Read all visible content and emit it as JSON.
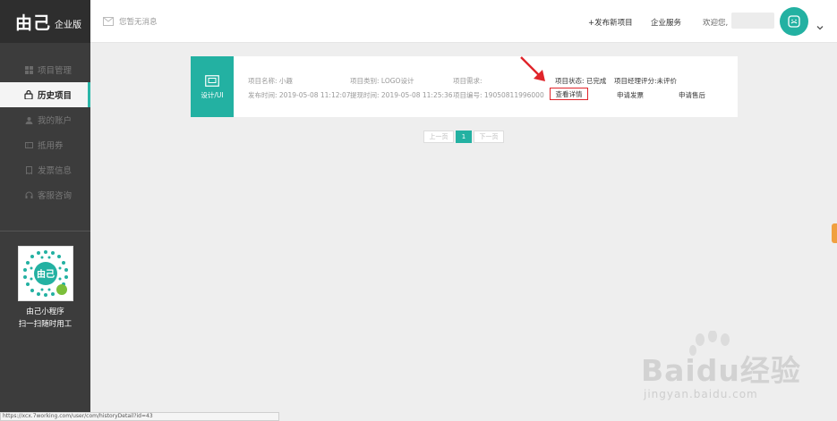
{
  "brand": {
    "logo_mark": "由己",
    "logo_sub": "企业版"
  },
  "sidebar": {
    "items": [
      {
        "label": "项目管理",
        "icon": "grid-icon",
        "active": false
      },
      {
        "label": "历史项目",
        "icon": "lock-icon",
        "active": true
      },
      {
        "label": "我的账户",
        "icon": "user-icon",
        "active": false
      },
      {
        "label": "抵用券",
        "icon": "coupon-icon",
        "active": false
      },
      {
        "label": "发票信息",
        "icon": "invoice-icon",
        "active": false
      },
      {
        "label": "客服咨询",
        "icon": "headset-icon",
        "active": false
      }
    ],
    "qr": {
      "line1": "由己小程序",
      "line2": "扫一扫随时用工"
    }
  },
  "header": {
    "message": "您暂无消息",
    "publish_link": "+发布新项目",
    "service_link": "企业服务",
    "welcome": "欢迎您,"
  },
  "project_card": {
    "category_tag": "设计/UI",
    "name_label": "项目名称: 小趣",
    "type_label": "项目类别: LOGO设计",
    "requirement_label": "项目需求:",
    "publish_time": "发布时间: 2019-05-08 11:12:07",
    "submit_time": "提现时间: 2019-05-08 11:25:36",
    "project_no": "项目编号: 19050811996000",
    "status": "项目状态: 已完成",
    "manager_rating": "项目经理评分:未评价",
    "detail_button": "查看详情",
    "invoice_link": "申请发票",
    "aftersale_link": "申请售后"
  },
  "pagination": {
    "prev": "上一页",
    "current": "1",
    "next": "下一页"
  },
  "status_bar_url": "https://xcx.7working.com/user/com/historyDetail?id=43",
  "watermark": {
    "text": "Baidu经验",
    "url": "jingyan.baidu.com"
  },
  "colors": {
    "accent": "#23b1a2",
    "sidebar_bg": "#3c3c3c",
    "highlight": "#e0242a"
  }
}
